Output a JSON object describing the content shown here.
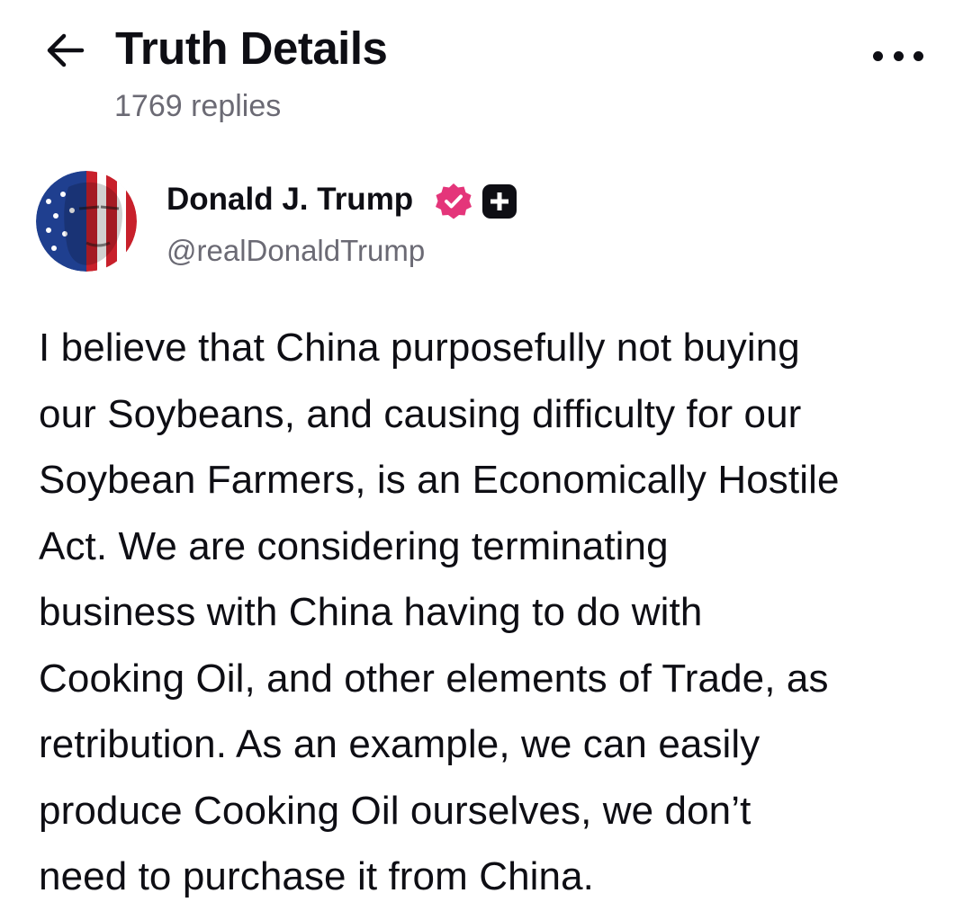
{
  "header": {
    "title": "Truth Details",
    "reply_count": "1769 replies",
    "back_icon": "arrow-left-icon",
    "more_icon": "more-horizontal-icon"
  },
  "post": {
    "author": {
      "display_name": "Donald J. Trump",
      "handle": "@realDonaldTrump",
      "verified_icon": "verified-badge-icon",
      "plus_icon": "truth-plus-icon"
    },
    "body": "I believe that China purposefully not buying\nour Soybeans, and causing difficulty for our\nSoybean Farmers, is an Economically Hostile\nAct. We are considering terminating\nbusiness with China having to do with\nCooking Oil, and other elements of Trade, as\nretribution. As an example, we can easily\nproduce Cooking Oil ourselves, we don’t\nneed to purchase it from China."
  },
  "colors": {
    "text": "#0e0e14",
    "muted": "#6b6a74",
    "verified": "#e4357a"
  }
}
